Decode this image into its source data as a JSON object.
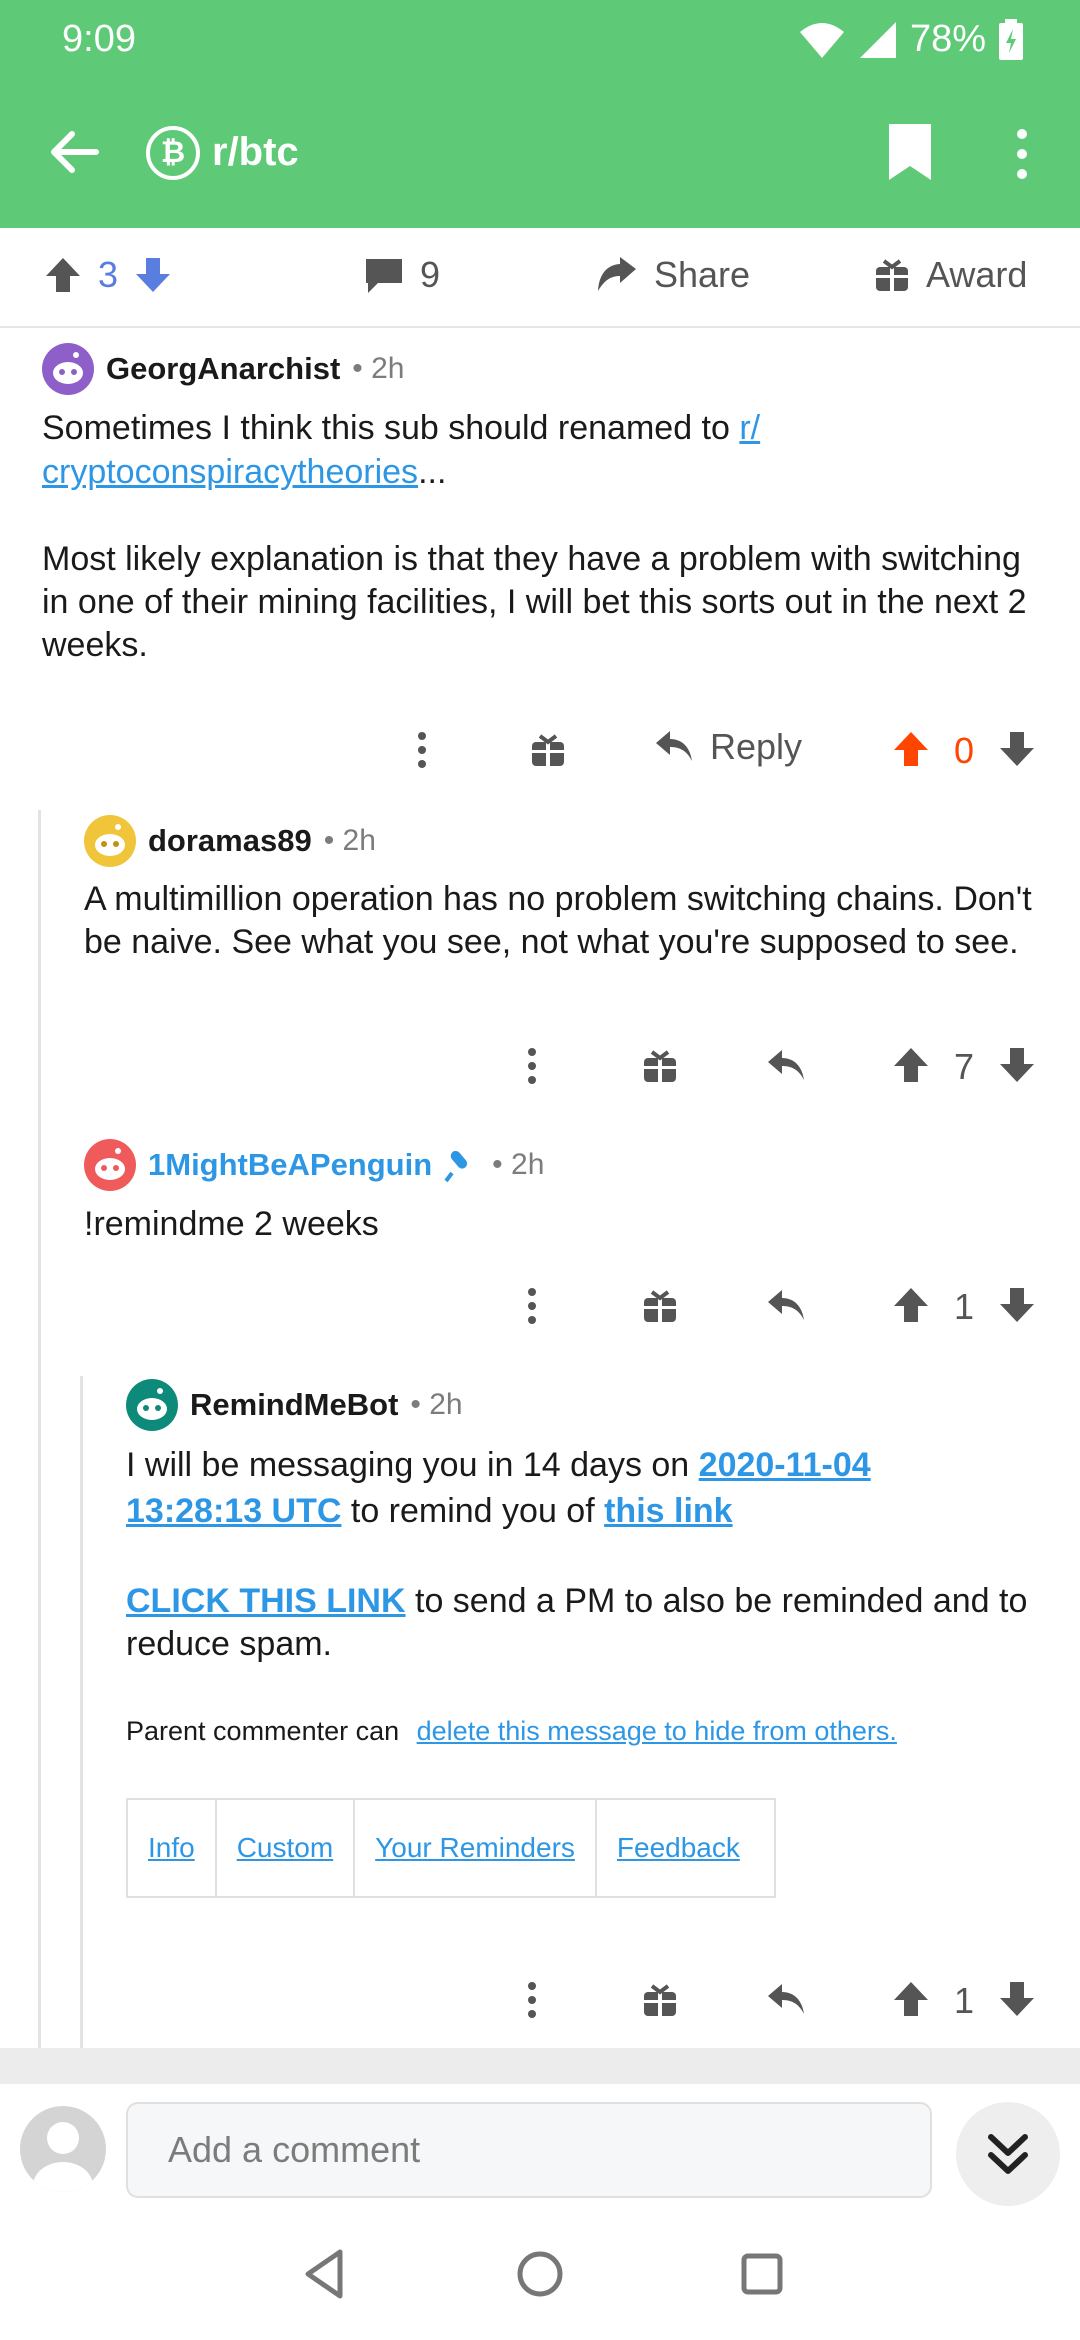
{
  "status_bar": {
    "time": "9:09",
    "battery": "78%"
  },
  "toolbar": {
    "subreddit": "r/btc",
    "sub_icon_glyph": "₿"
  },
  "post_actions": {
    "score": "3",
    "comments": "9",
    "share_label": "Share",
    "award_label": "Award"
  },
  "comments": [
    {
      "author": "GeorgAnarchist",
      "time": "• 2h",
      "body_pre": "Sometimes I think this sub should renamed to ",
      "body_link_1": "r/",
      "body_link_2": "cryptoconspiracytheories",
      "body_post": "...",
      "body_p2": "Most likely explanation is that they have a problem with switching in one of their mining facilities, I will bet this sorts out in the next 2 weeks.",
      "reply_label": "Reply",
      "score": "0"
    },
    {
      "author": "doramas89",
      "time": "• 2h",
      "body": "A multimillion operation has no problem switching chains. Don't be naive. See what you see, not what you're supposed to see.",
      "score": "7"
    },
    {
      "author": "1MightBeAPenguin",
      "time": "• 2h",
      "body": "!remindme 2 weeks",
      "score": "1"
    },
    {
      "author": "RemindMeBot",
      "time": "• 2h",
      "p1_pre": "I will be messaging you in 14 days on ",
      "p1_link_date_1": "2020-11-04",
      "p1_link_date_2": "13:28:13 UTC",
      "p1_mid": " to remind you of ",
      "p1_link_this": "this link",
      "p2_link": "CLICK THIS LINK",
      "p2_post": " to send a PM to also be reminded and to reduce spam.",
      "p3_pre": "Parent commenter can ",
      "p3_link": "delete this message to hide from others.",
      "table": [
        "Info",
        "Custom",
        "Your Reminders",
        "Feedback"
      ],
      "score": "1"
    }
  ],
  "bottom": {
    "placeholder": "Add a comment"
  },
  "colors": {
    "header": "#5ec976",
    "upvote_active": "#ff4500",
    "link": "#2d97e5",
    "score_blue": "#5a7de0"
  }
}
